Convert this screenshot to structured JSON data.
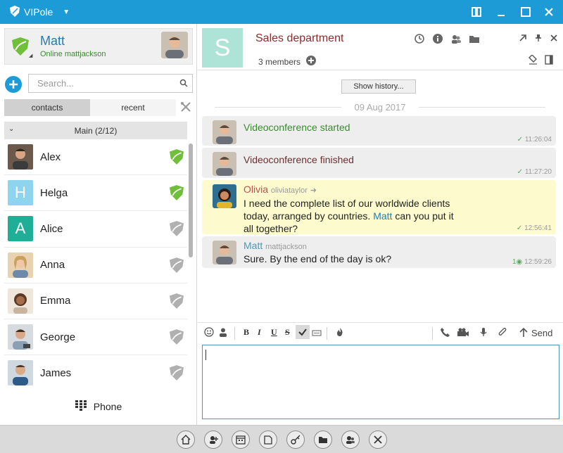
{
  "window": {
    "app_name": "VIPole"
  },
  "profile": {
    "name": "Matt",
    "status": "Online mattjackson"
  },
  "search": {
    "placeholder": "Search..."
  },
  "tabs": [
    {
      "label": "contacts",
      "active": true
    },
    {
      "label": "recent",
      "active": false
    }
  ],
  "group": {
    "label": "Main (2/12)"
  },
  "contacts": [
    {
      "name": "Alex",
      "avatar": "photo",
      "online": true
    },
    {
      "name": "Helga",
      "avatar": "letter",
      "letter": "H",
      "color": "#8ed4ef",
      "online": true
    },
    {
      "name": "Alice",
      "avatar": "letter",
      "letter": "A",
      "color": "#1fae96",
      "online": false
    },
    {
      "name": "Anna",
      "avatar": "photo",
      "online": false
    },
    {
      "name": "Emma",
      "avatar": "photo",
      "online": false
    },
    {
      "name": "George",
      "avatar": "photo",
      "online": false
    },
    {
      "name": "James",
      "avatar": "photo",
      "online": false
    }
  ],
  "phone": {
    "label": "Phone"
  },
  "chat": {
    "letter": "S",
    "title": "Sales department",
    "members": "3 members",
    "history_button": "Show history...",
    "date": "09 Aug 2017",
    "messages": [
      {
        "text": "Videoconference started",
        "time": "11:26:04"
      },
      {
        "text": "Videoconference finished",
        "time": "11:27:20"
      },
      {
        "sender": "Olivia",
        "login": "oliviataylor",
        "line1": "I need the complete list of our worldwide clients",
        "line2a": "today, arranged by countries.",
        "mention": "Matt",
        "line2b": "can you put it",
        "line3": "all together?",
        "time": "12:56:41"
      },
      {
        "sender": "Matt",
        "login": "mattjackson",
        "text": "Sure. By the end of the day is ok?",
        "read_count": "1",
        "time": "12:59:26"
      }
    ]
  },
  "composer": {
    "bold": "B",
    "italic": "I",
    "underline": "U",
    "strike": "S",
    "send_label": "Send"
  },
  "colors": {
    "accent": "#1c9bd6",
    "online_shield": "#6fbf3a",
    "offline_shield": "#b0b0b0",
    "highlight": "#fdfbcd"
  }
}
